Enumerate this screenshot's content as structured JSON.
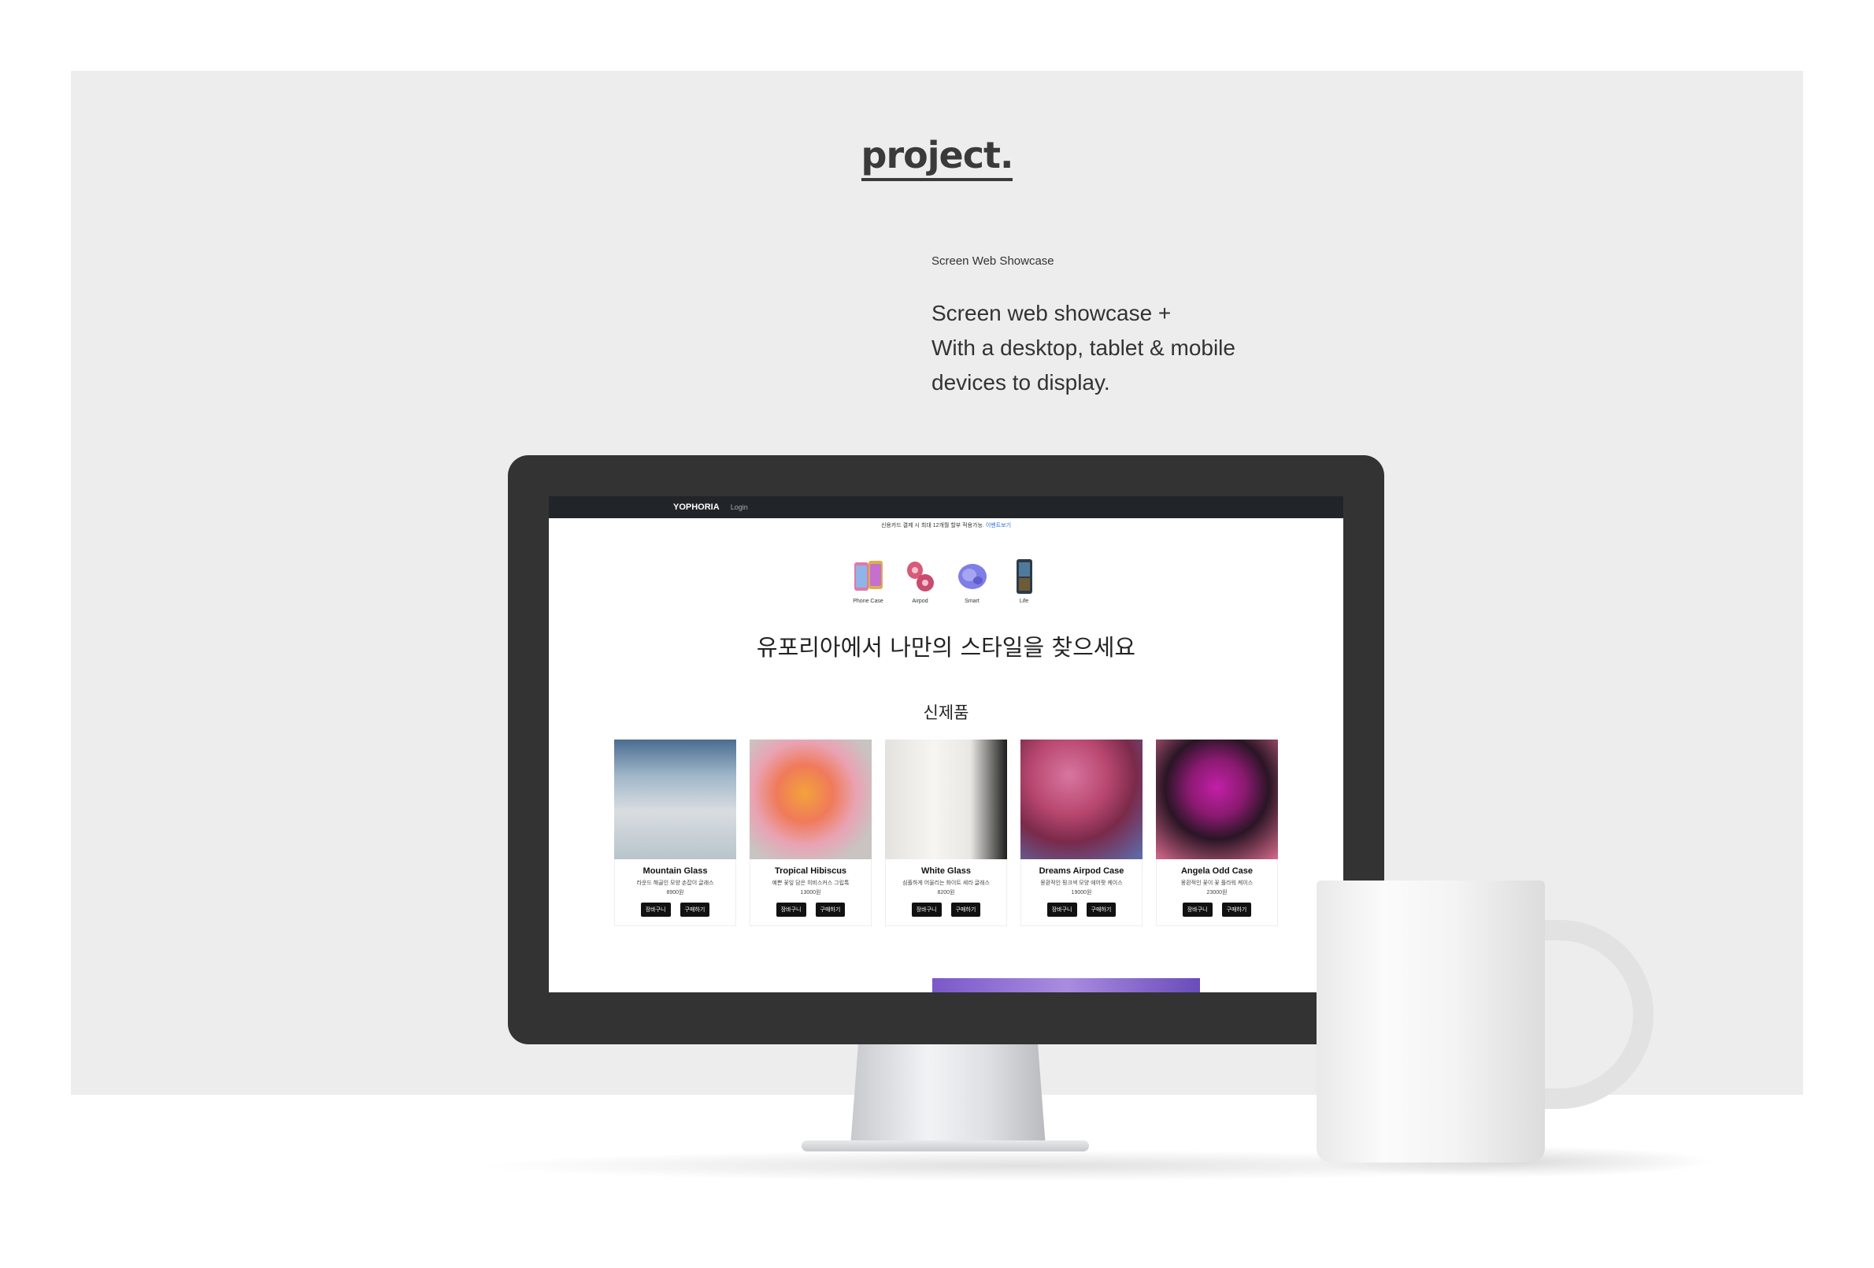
{
  "showcase": {
    "title": "project.",
    "subtitle": "Screen Web Showcase",
    "description_lines": [
      "Screen web showcase +",
      "With a desktop, tablet & mobile",
      "devices to display."
    ]
  },
  "site": {
    "brand": "YOPHORIA",
    "login": "Login",
    "notice": "신용카드 결제 시 최대 12개월 할부 적용가능.",
    "notice_link": "이벤트보기",
    "categories": [
      {
        "label": "Phone Case",
        "icon": "phone-case-icon"
      },
      {
        "label": "Airpod",
        "icon": "airpod-icon"
      },
      {
        "label": "Smart",
        "icon": "smart-icon"
      },
      {
        "label": "Life",
        "icon": "life-icon"
      }
    ],
    "hero": "유포리아에서 나만의 스타일을 찾으세요",
    "new_section": "신제품",
    "cart_label": "장바구니",
    "buy_label": "구매하기",
    "products": [
      {
        "name": "Mountain Glass",
        "desc": "라운드 해골인 모양 손잡이 글래스",
        "price": "8900원"
      },
      {
        "name": "Tropical Hibiscus",
        "desc": "예쁜 꽃잎 담은 히비스커스 그립톡",
        "price": "13000원"
      },
      {
        "name": "White Glass",
        "desc": "심플하게 어울리는 화이트 세라 글래스",
        "price": "8200원"
      },
      {
        "name": "Dreams Airpod Case",
        "desc": "몽환적인 핑크색 모양 에어팟 케이스",
        "price": "19000원"
      },
      {
        "name": "Angela Odd Case",
        "desc": "몽환적인 꽃이 꽃 플라워 케이스",
        "price": "23000원"
      }
    ]
  },
  "colors": {
    "panel": "#ededed",
    "monitor_bezel": "#333333",
    "nav_bar": "#212529"
  }
}
